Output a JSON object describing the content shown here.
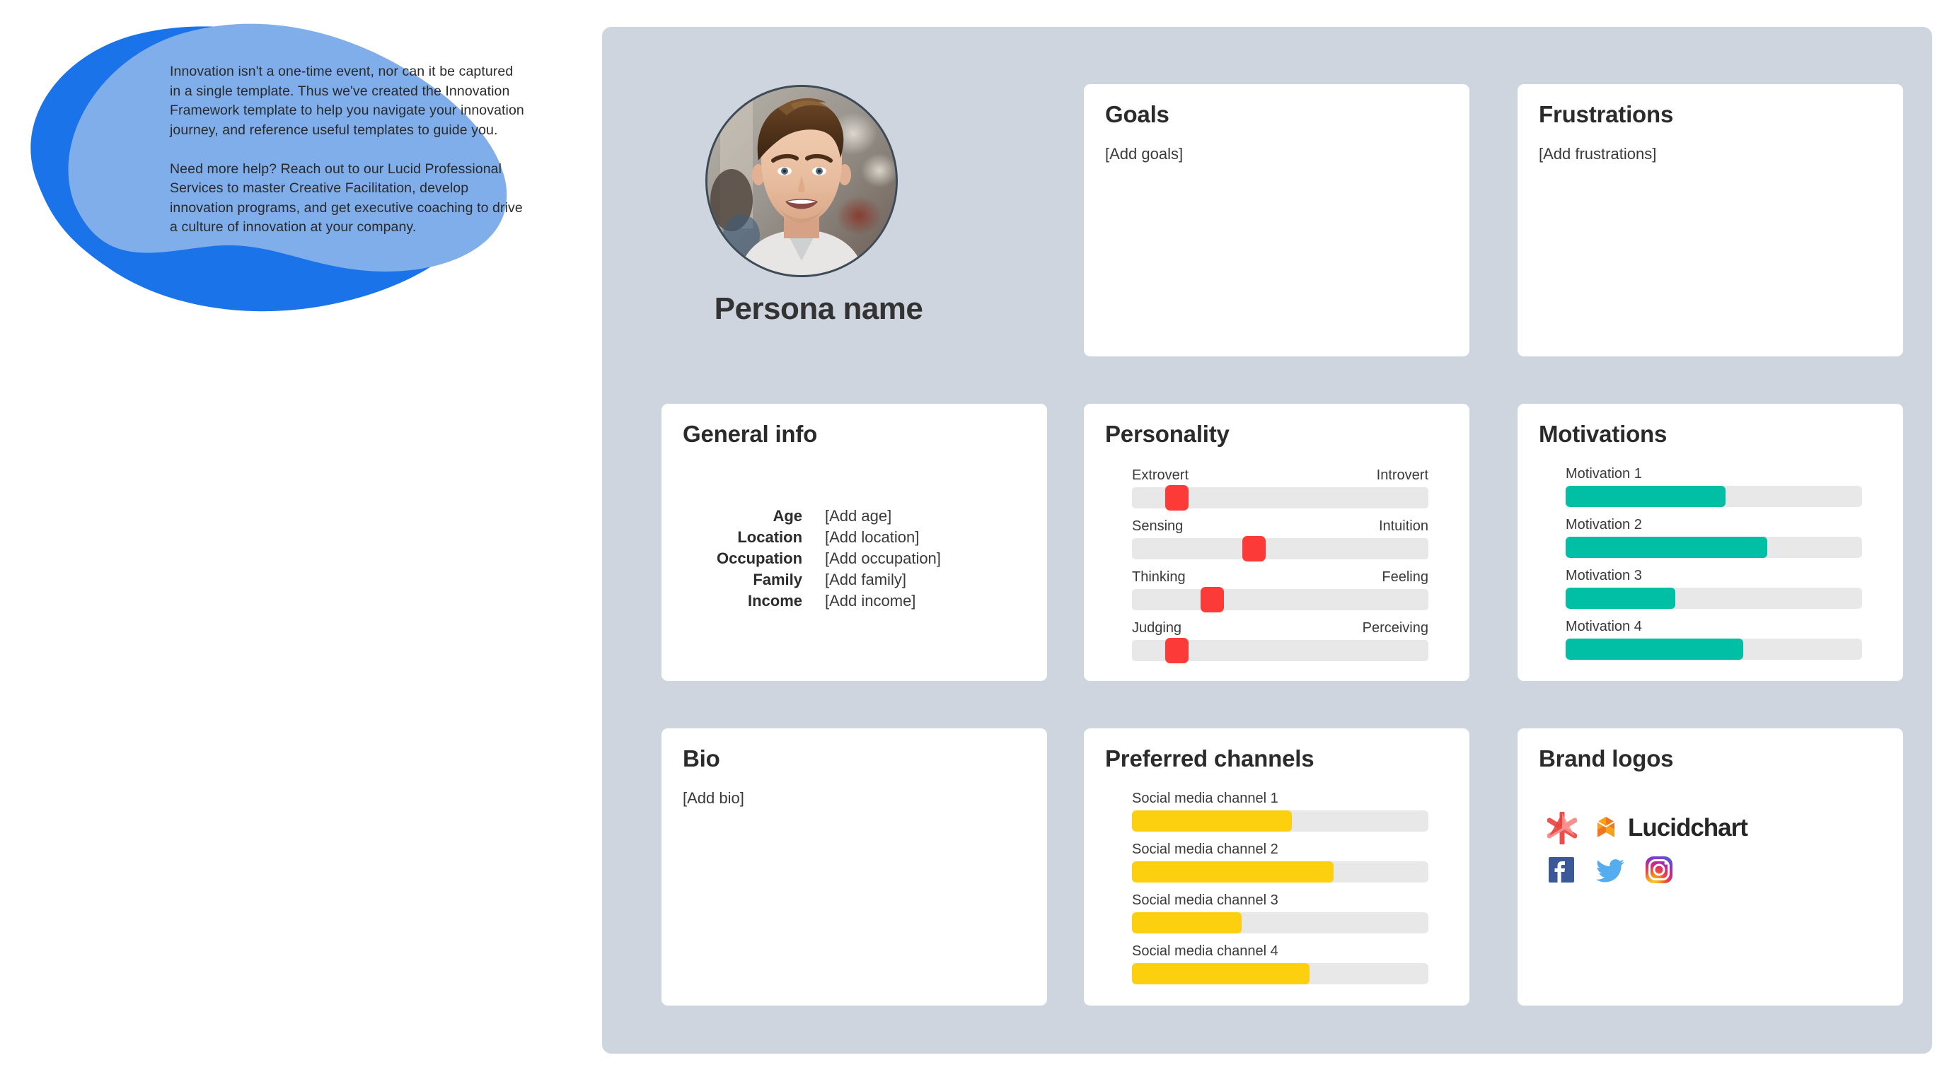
{
  "intro": {
    "paragraph_1": "Innovation isn't a one-time event, nor can it be captured in a single template. Thus we've created the Innovation Framework template to help you navigate your innovation journey, and reference useful templates to guide you.",
    "paragraph_2": "Need more help? Reach out to our Lucid Professional Services to master Creative Facilitation, develop innovation programs, and get executive coaching to drive a culture of innovation at your company."
  },
  "persona": {
    "name": "Persona name",
    "avatar_alt": "avatar-photo"
  },
  "goals": {
    "title": "Goals",
    "placeholder": "[Add goals]"
  },
  "frustrations": {
    "title": "Frustrations",
    "placeholder": "[Add frustrations]"
  },
  "general_info": {
    "title": "General info",
    "rows": [
      {
        "label": "Age",
        "value": "[Add age]"
      },
      {
        "label": "Location",
        "value": "[Add location]"
      },
      {
        "label": "Occupation",
        "value": "[Add occupation]"
      },
      {
        "label": "Family",
        "value": "[Add family]"
      },
      {
        "label": "Income",
        "value": "[Add income]"
      }
    ]
  },
  "personality": {
    "title": "Personality",
    "thumb_color": "#fc3b38",
    "track_color": "#e8e8e8",
    "sliders": [
      {
        "left": "Extrovert",
        "right": "Introvert",
        "position": 15
      },
      {
        "left": "Sensing",
        "right": "Intuition",
        "position": 41
      },
      {
        "left": "Thinking",
        "right": "Feeling",
        "position": 27
      },
      {
        "left": "Judging",
        "right": "Perceiving",
        "position": 15
      }
    ]
  },
  "motivations": {
    "title": "Motivations",
    "fill_color": "#00bfa5",
    "track_color": "#e8e8e8",
    "bars": [
      {
        "label": "Motivation 1",
        "value": 54
      },
      {
        "label": "Motivation 2",
        "value": 68
      },
      {
        "label": "Motivation 3",
        "value": 37
      },
      {
        "label": "Motivation 4",
        "value": 60
      }
    ]
  },
  "bio": {
    "title": "Bio",
    "placeholder": "[Add bio]"
  },
  "preferred_channels": {
    "title": "Preferred channels",
    "fill_color": "#fccf0f",
    "track_color": "#e8e8e8",
    "bars": [
      {
        "label": "Social media channel 1",
        "value": 54
      },
      {
        "label": "Social media channel 2",
        "value": 68
      },
      {
        "label": "Social media channel 3",
        "value": 37
      },
      {
        "label": "Social media channel 4",
        "value": 60
      }
    ]
  },
  "brand_logos": {
    "title": "Brand logos",
    "logos": [
      {
        "name": "lucid-asterisk-logo",
        "label": ""
      },
      {
        "name": "lucidchart-logo",
        "label": "Lucidchart"
      },
      {
        "name": "facebook-logo",
        "label": ""
      },
      {
        "name": "twitter-logo",
        "label": ""
      },
      {
        "name": "instagram-logo",
        "label": ""
      }
    ]
  },
  "theme": {
    "board_background": "#ced5de",
    "card_background": "#ffffff",
    "blob_dark": "#1a73e8",
    "blob_light": "#7faeea",
    "text_dark": "#2b2b2b"
  }
}
